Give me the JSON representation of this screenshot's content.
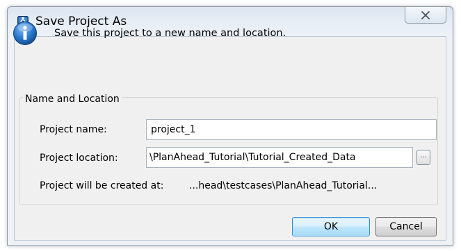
{
  "window": {
    "title": "Save Project As",
    "close_glyph": "close-icon"
  },
  "message": {
    "icon": "info-icon",
    "text": "Save this project to a new name and location."
  },
  "group": {
    "title": "Name and Location",
    "project_name_label": "Project name:",
    "project_name_value": "project_1",
    "project_location_label": "Project location:",
    "project_location_value": "\\PlanAhead_Tutorial\\Tutorial_Created_Data",
    "browse_label": "...",
    "created_at_label": "Project will be created at:",
    "created_at_value": "...head\\testcases\\PlanAhead_Tutorial..."
  },
  "buttons": {
    "ok": "OK",
    "cancel": "Cancel"
  },
  "colors": {
    "ok_border": "#3c8fd6",
    "info_blue": "#1f6fc5"
  }
}
